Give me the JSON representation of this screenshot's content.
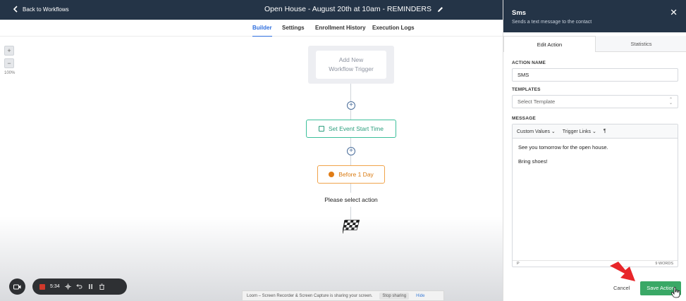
{
  "header": {
    "back_label": "Back to Workflows",
    "workflow_title": "Open House - August 20th at 10am - REMINDERS"
  },
  "tabs": [
    {
      "label": "Builder",
      "active": true
    },
    {
      "label": "Settings",
      "active": false
    },
    {
      "label": "Enrollment History",
      "active": false
    },
    {
      "label": "Execution Logs",
      "active": false
    }
  ],
  "canvas": {
    "zoom_in": "+",
    "zoom_out": "−",
    "zoom_level": "100%",
    "trigger_line1": "Add New",
    "trigger_line2": "Workflow Trigger",
    "node_start": "Set Event Start Time",
    "node_before": "Before 1 Day",
    "select_action": "Please select action"
  },
  "recorder": {
    "time": "5:34"
  },
  "share_bar": {
    "message": "Loom – Screen Recorder & Screen Capture is sharing your screen.",
    "stop_label": "Stop sharing",
    "hide_label": "Hide"
  },
  "panel": {
    "title": "Sms",
    "subtitle": "Sends a text message to the contact",
    "close": "✕",
    "tabs": [
      "Edit Action",
      "Statistics"
    ],
    "action_name_label": "ACTION NAME",
    "action_name_value": "SMS",
    "templates_label": "TEMPLATES",
    "templates_placeholder": "Select Template",
    "message_label": "MESSAGE",
    "tool_custom_values": "Custom Values",
    "tool_trigger_links": "Trigger Links",
    "tool_paragraph": "¶",
    "message_line1": "See you tomorrow for the open house.",
    "message_line2": "Bring shoes!",
    "footer_tag": "P",
    "word_count": "9 WORDS",
    "cancel_label": "Cancel",
    "save_label": "Save Action"
  },
  "colors": {
    "header_bg": "#243447",
    "accent_blue": "#2f6fde",
    "start_node": "#3bbf9a",
    "before_node": "#f0a34a",
    "save_green": "#3aa866",
    "annotation_red": "#e8262a"
  }
}
